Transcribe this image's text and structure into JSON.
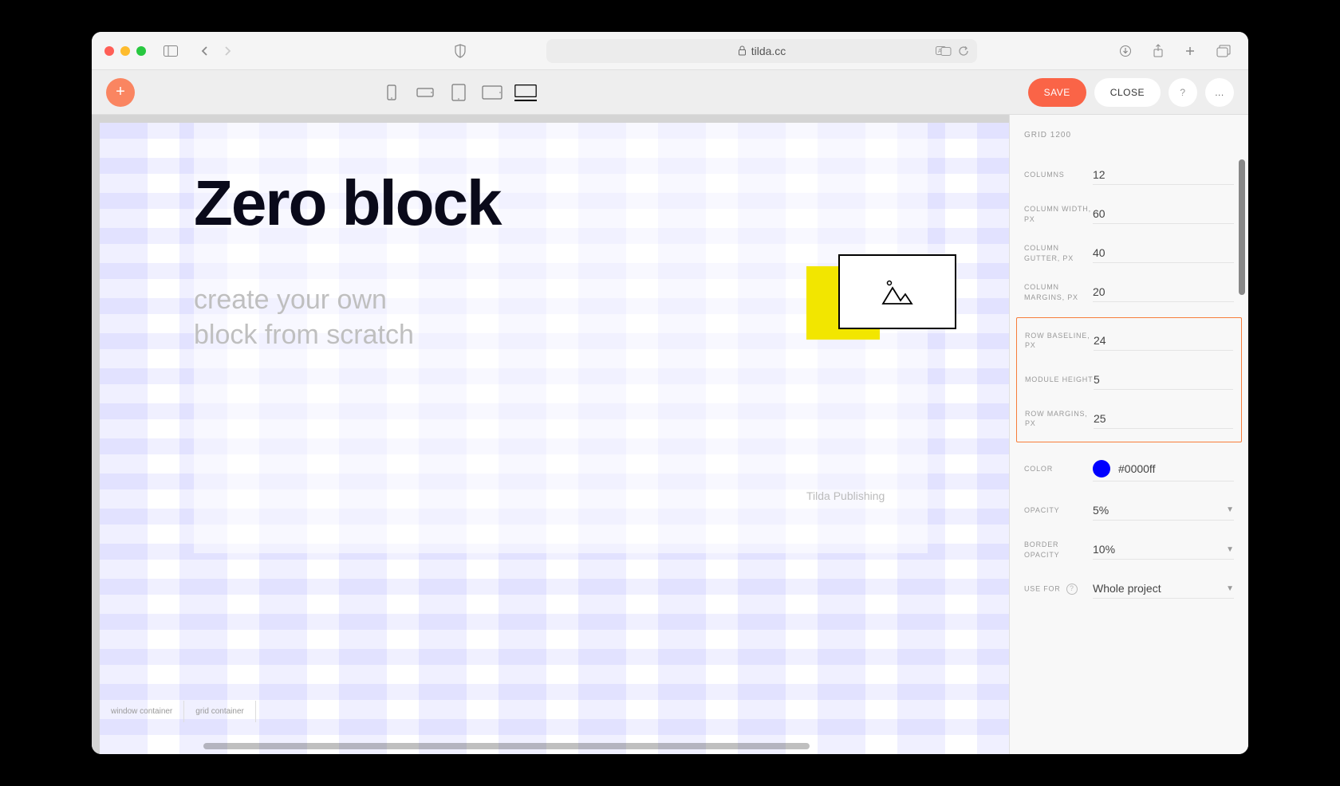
{
  "browser": {
    "url": "tilda.cc"
  },
  "toolbar": {
    "save_label": "SAVE",
    "close_label": "CLOSE",
    "more_label": "..."
  },
  "canvas": {
    "heading": "Zero block",
    "subheading": "create your own\nblock from scratch",
    "credit": "Tilda Publishing",
    "footer_tabs": [
      "window container",
      "grid container"
    ]
  },
  "panel": {
    "title": "GRID 1200",
    "rows": {
      "columns": {
        "label": "Columns",
        "value": "12"
      },
      "column_width": {
        "label": "Column Width, px",
        "value": "60"
      },
      "column_gutter": {
        "label": "Column Gutter, px",
        "value": "40"
      },
      "column_margins": {
        "label": "Column Margins, px",
        "value": "20"
      },
      "row_baseline": {
        "label": "Row Baseline, px",
        "value": "24"
      },
      "module_height": {
        "label": "Module Height",
        "value": "5"
      },
      "row_margins": {
        "label": "Row Margins, px",
        "value": "25"
      },
      "color": {
        "label": "Color",
        "value": "#0000ff"
      },
      "opacity": {
        "label": "Opacity",
        "value": "5%"
      },
      "border_opacity": {
        "label": "Border Opacity",
        "value": "10%"
      },
      "use_for": {
        "label": "Use for",
        "value": "Whole project"
      }
    }
  }
}
